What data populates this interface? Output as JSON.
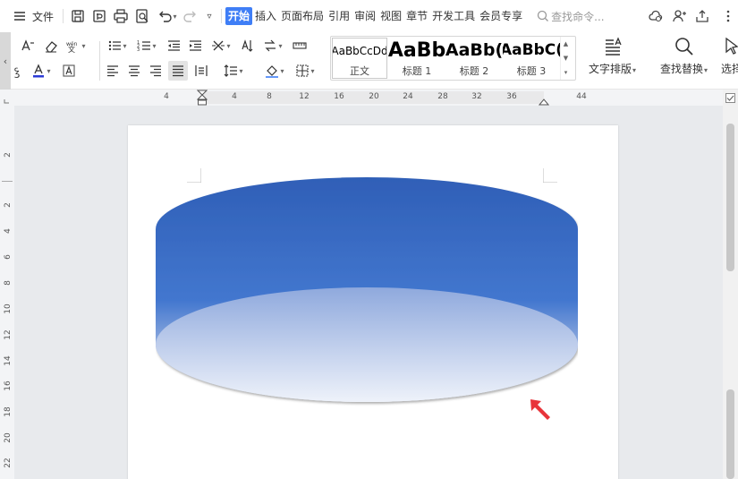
{
  "menubar": {
    "file_label": "文件",
    "tabs": [
      {
        "label": "开始",
        "active": true
      },
      {
        "label": "插入"
      },
      {
        "label": "页面布局"
      },
      {
        "label": "引用"
      },
      {
        "label": "审阅"
      },
      {
        "label": "视图"
      },
      {
        "label": "章节"
      },
      {
        "label": "开发工具"
      },
      {
        "label": "会员专享"
      }
    ],
    "search_placeholder": "查找命令..."
  },
  "ribbon": {
    "styles": [
      {
        "preview": "AaBbCcDd",
        "name": "正文"
      },
      {
        "preview": "AaBb",
        "name": "标题 1"
      },
      {
        "preview": "AaBb(",
        "name": "标题 2"
      },
      {
        "preview": "AaBbC(",
        "name": "标题 3"
      }
    ],
    "text_layout_label": "文字排版",
    "find_replace_label": "查找替换",
    "select_label": "选择"
  },
  "ruler": {
    "h_ticks": [
      "4",
      "4",
      "8",
      "12",
      "16",
      "20",
      "24",
      "28",
      "32",
      "36",
      "44"
    ],
    "v_ticks": [
      "2",
      "2",
      "4",
      "6",
      "8",
      "10",
      "12",
      "14",
      "16",
      "18",
      "20",
      "22"
    ]
  },
  "colors": {
    "accent": "#3f7ef6",
    "cylinder_top": "#2f5fb7",
    "cylinder_bottom": "#e8eef8",
    "arrow": "#e8343a"
  },
  "icons": [
    "hamburger-icon",
    "save-icon",
    "export-pdf-icon",
    "print-icon",
    "print-preview-icon",
    "undo-icon",
    "redo-icon",
    "more-icon",
    "search-icon",
    "cloud-icon",
    "share-user-icon",
    "share-icon",
    "more-vertical-icon"
  ]
}
